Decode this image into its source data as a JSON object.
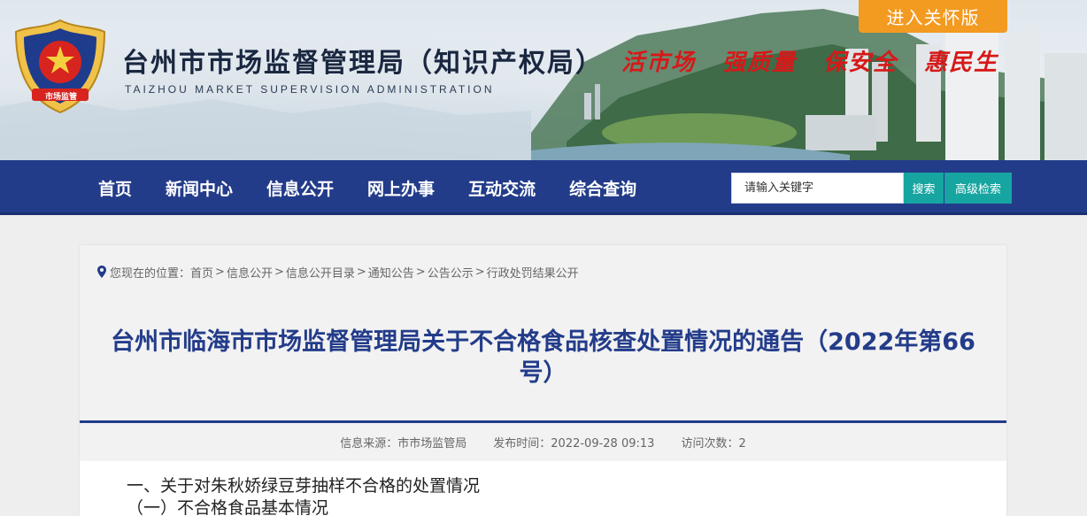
{
  "header": {
    "site_name": "台州市市场监督管理局（知识产权局）",
    "site_name_en": "TAIZHOU MARKET SUPERVISION ADMINISTRATION",
    "emblem_text": "市场监管",
    "slogans": [
      "活市场",
      "强质量",
      "保安全",
      "惠民生"
    ],
    "care_mode_label": "进入关怀版"
  },
  "nav": {
    "items": [
      "首页",
      "新闻中心",
      "信息公开",
      "网上办事",
      "互动交流",
      "综合查询"
    ],
    "search_placeholder": "请输入关键字",
    "search_label": "搜索",
    "advanced_label": "高级检索"
  },
  "breadcrumb": {
    "prefix": "您现在的位置：",
    "items": [
      "首页",
      "信息公开",
      "信息公开目录",
      "通知公告",
      "公告公示",
      "行政处罚结果公开"
    ],
    "separator": ">"
  },
  "article": {
    "title": "台州市临海市市场监督管理局关于不合格食品核查处置情况的通告（2022年第66号）",
    "source": "信息来源：市市场监管局",
    "publish_time": "发布时间：2022-09-28 09:13",
    "visits": "访问次数：2",
    "paragraphs": [
      "一、关于对朱秋娇绿豆芽抽样不合格的处置情况",
      "（一）不合格食品基本情况"
    ]
  },
  "colors": {
    "nav_bg": "#233c8a",
    "title_color": "#233c8a",
    "slogan_red": "#d71818",
    "care_orange": "#f39a21",
    "search_teal": "#17a5a1"
  }
}
